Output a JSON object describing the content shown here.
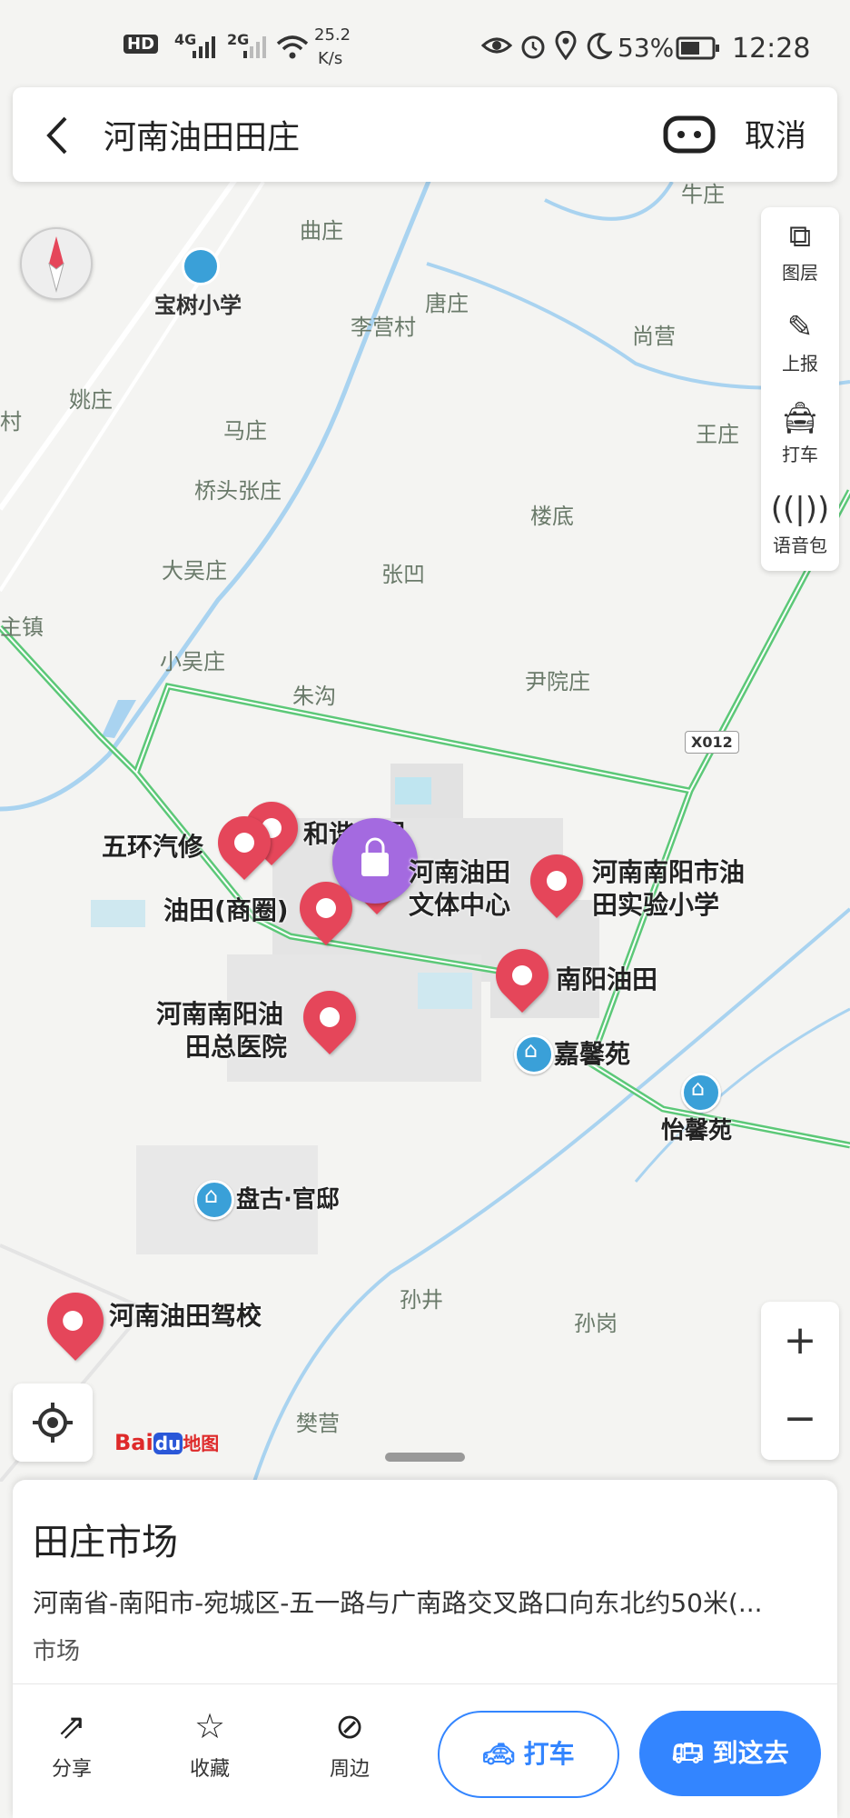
{
  "status_bar": {
    "net_hd": "HD",
    "sig1": "4G",
    "sig2": "2G",
    "speed_value": "25.2",
    "speed_unit": "K/s",
    "battery": "53%",
    "time": "12:28"
  },
  "search": {
    "query": "河南油田田庄",
    "cancel_label": "取消"
  },
  "toolbar": {
    "layers_label": "图层",
    "report_label": "上报",
    "taxi_label": "打车",
    "voice_label": "语音包"
  },
  "map": {
    "road_label": "X012",
    "places": [
      "牛庄",
      "曲庄",
      "宝树小学",
      "唐庄",
      "李营村",
      "尚营",
      "姚庄",
      "村",
      "马庄",
      "王庄",
      "桥头张庄",
      "楼底",
      "大吴庄",
      "张凹",
      "主镇",
      "小吴庄",
      "朱沟",
      "尹院庄",
      "孙井",
      "孙岗",
      "樊营"
    ],
    "pois": {
      "wuhuan": "五环汽修",
      "hexie": "和谐家园",
      "culture_l1": "河南油田",
      "culture_l2": "文体中心",
      "school_l1": "河南南阳市油",
      "school_l2": "田实验小学",
      "shangquan": "油田(商圈)",
      "nanyang": "南阳油田",
      "hospital_l1": "河南南阳油",
      "hospital_l2": "田总医院",
      "jiaxin": "嘉馨苑",
      "yixin": "怡馨苑",
      "pangu": "盘古·官邸",
      "driving": "河南油田驾校"
    },
    "logo_text": "Bai",
    "logo_du": "du",
    "logo_map": "地图"
  },
  "card": {
    "title": "田庄市场",
    "address": "河南省-南阳市-宛城区-五一路与广南路交叉路口向东北约50米(...",
    "category": "市场",
    "actions": {
      "share": "分享",
      "favorite": "收藏",
      "nearby": "周边"
    },
    "taxi_button": "打车",
    "go_button": "到这去"
  },
  "colors": {
    "accent": "#3385ff",
    "pin": "#e5465a",
    "road": "#5cc878",
    "water": "#a9d3f0",
    "selected_pin": "#a46ae0"
  }
}
